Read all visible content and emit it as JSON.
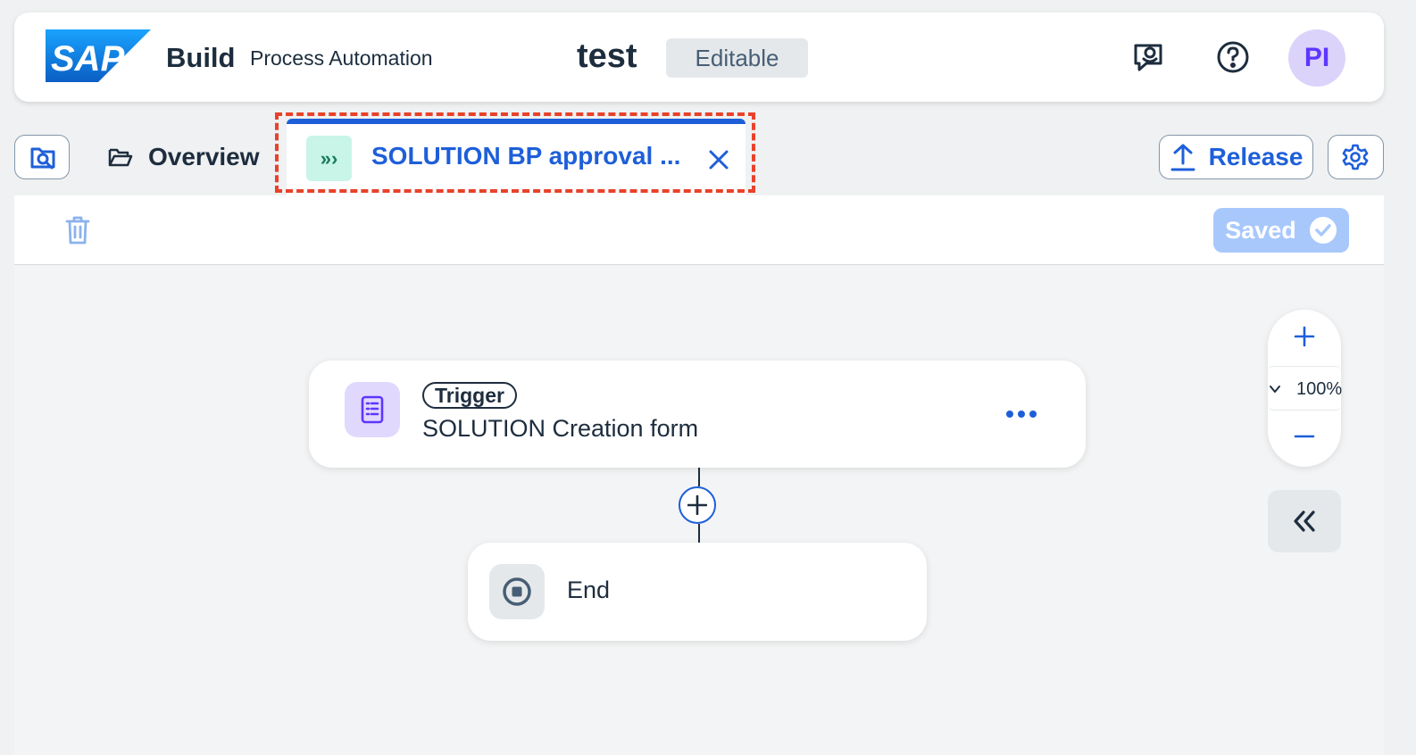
{
  "header": {
    "logo_text": "SAP",
    "product_name": "Build",
    "product_subtitle": "Process Automation",
    "project_name": "test",
    "project_status": "Editable",
    "avatar_initials": "PI",
    "icons": [
      "feedback-icon",
      "help-icon"
    ]
  },
  "tabs": {
    "overview_label": "Overview",
    "active_label": "SOLUTION BP approval ...",
    "active_icon": "process-icon",
    "accent_color": "#1e5fd9"
  },
  "actions": {
    "release_label": "Release",
    "saved_label": "Saved"
  },
  "canvas": {
    "trigger": {
      "badge": "Trigger",
      "title": "SOLUTION Creation form"
    },
    "end": {
      "label": "End"
    }
  },
  "zoom": {
    "level": "100%"
  }
}
